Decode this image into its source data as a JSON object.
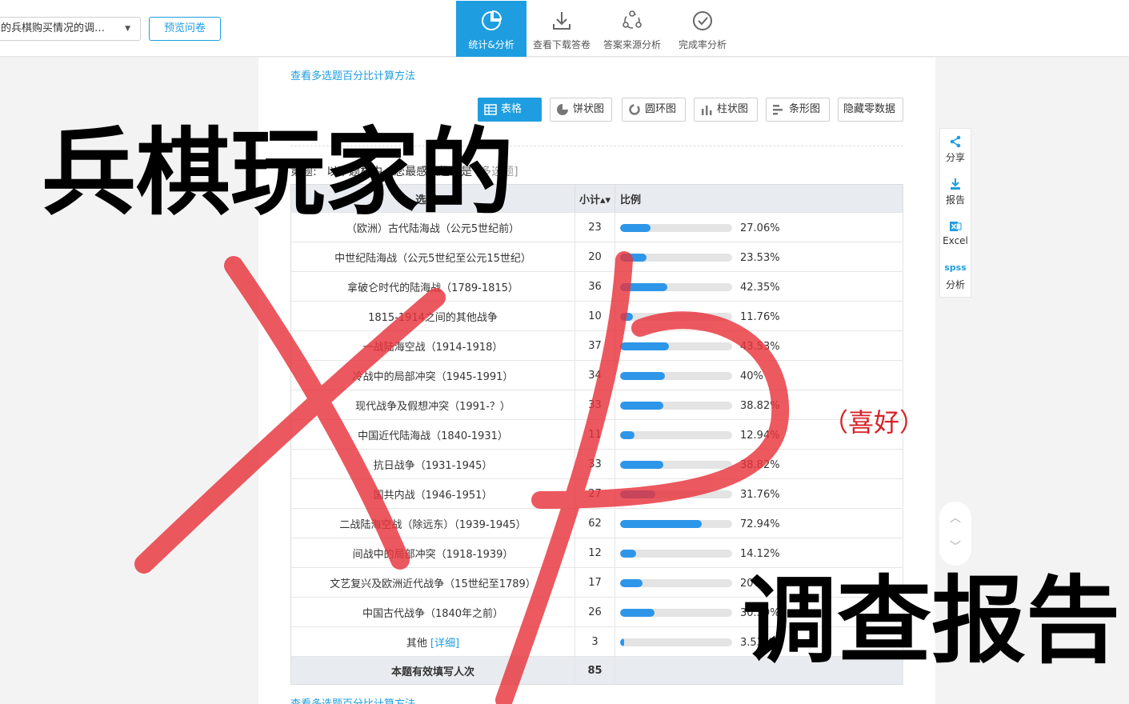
{
  "header": {
    "survey_name": "的兵棋购买情况的调…",
    "preview_label": "预览问卷",
    "tabs": [
      {
        "label": "统计&分析",
        "icon": "pie-chart-icon",
        "active": true
      },
      {
        "label": "查看下载答卷",
        "icon": "download-icon",
        "active": false
      },
      {
        "label": "答案来源分析",
        "icon": "share-nodes-icon",
        "active": false
      },
      {
        "label": "完成率分析",
        "icon": "check-circle-icon",
        "active": false
      }
    ]
  },
  "main": {
    "calc_link": "查看多选题百分比计算方法",
    "toolbar": [
      {
        "label": "表格",
        "icon": "table-icon",
        "active": true
      },
      {
        "label": "饼状图",
        "icon": "pie-icon",
        "active": false
      },
      {
        "label": "圆环图",
        "icon": "donut-icon",
        "active": false
      },
      {
        "label": "柱状图",
        "icon": "bar-chart-icon",
        "active": false
      },
      {
        "label": "条形图",
        "icon": "horizontal-bar-icon",
        "active": false
      },
      {
        "label": "隐藏零数据",
        "icon": "",
        "active": false
      }
    ],
    "question": {
      "prefix": "第",
      "mid": "题:",
      "body": "以下题材中，您最感兴趣的是",
      "type_hint": "[多选题]"
    },
    "columns": {
      "option": "选项",
      "count": "小计",
      "ratio": "比例"
    },
    "rows": [
      {
        "option": "（欧洲）古代陆海战（公元5世纪前）",
        "count": "23",
        "pct": "27.06%",
        "frac": 0.2706
      },
      {
        "option": "中世纪陆海战（公元5世纪至公元15世纪）",
        "count": "20",
        "pct": "23.53%",
        "frac": 0.2353
      },
      {
        "option": "拿破仑时代的陆海战（1789-1815）",
        "count": "36",
        "pct": "42.35%",
        "frac": 0.4235
      },
      {
        "option": "1815-1914之间的其他战争",
        "count": "10",
        "pct": "11.76%",
        "frac": 0.1176
      },
      {
        "option": "一战陆海空战（1914-1918）",
        "count": "37",
        "pct": "43.53%",
        "frac": 0.4353
      },
      {
        "option": "冷战中的局部冲突（1945-1991）",
        "count": "34",
        "pct": "40%",
        "frac": 0.4
      },
      {
        "option": "现代战争及假想冲突（1991-？）",
        "count": "33",
        "pct": "38.82%",
        "frac": 0.3882
      },
      {
        "option": "中国近代陆海战（1840-1931）",
        "count": "11",
        "pct": "12.94%",
        "frac": 0.1294
      },
      {
        "option": "抗日战争（1931-1945）",
        "count": "33",
        "pct": "38.82%",
        "frac": 0.3882
      },
      {
        "option": "国共内战（1946-1951）",
        "count": "27",
        "pct": "31.76%",
        "frac": 0.3176
      },
      {
        "option": "二战陆海空战（除远东）（1939-1945）",
        "count": "62",
        "pct": "72.94%",
        "frac": 0.7294
      },
      {
        "option": "间战中的局部冲突（1918-1939）",
        "count": "12",
        "pct": "14.12%",
        "frac": 0.1412
      },
      {
        "option": "文艺复兴及欧洲近代战争（15世纪至1789）",
        "count": "17",
        "pct": "20%",
        "frac": 0.2
      },
      {
        "option": "中国古代战争（1840年之前）",
        "count": "26",
        "pct": "30.59%",
        "frac": 0.3059
      },
      {
        "option": "其他",
        "detail": "[详细]",
        "count": "3",
        "pct": "3.53%",
        "frac": 0.0353
      }
    ],
    "total": {
      "label": "本题有效填写人次",
      "count": "85"
    },
    "bottom_link": "查看多选题百分比计算方法"
  },
  "sidebar": {
    "items": [
      {
        "label": "分享",
        "icon": "share-icon"
      },
      {
        "label": "报告",
        "icon": "download-report-icon"
      },
      {
        "label": "Excel",
        "icon": "excel-icon"
      },
      {
        "label": "分析",
        "icon": "spss-icon",
        "mark": "spss"
      }
    ]
  },
  "overlay": {
    "title": "兵棋玩家的",
    "subtitle": "调查报告",
    "note": "（喜好）",
    "stroke_color": "#e8343c"
  }
}
